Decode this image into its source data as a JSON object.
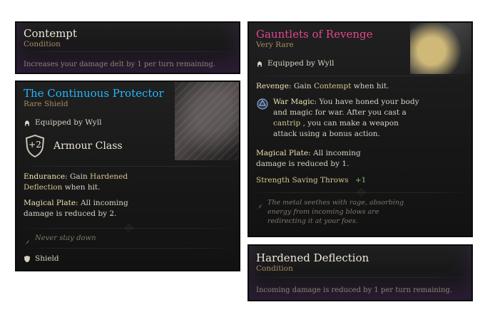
{
  "colors": {
    "title_white": "#ece6d8",
    "title_cyan": "#22b7ff",
    "title_magenta": "#e0478f",
    "sub_brown": "#a88a62",
    "text": "#d9d2c3",
    "gold_label": "#f2e3b3",
    "gold_value": "#d6c48e",
    "green": "#8fbf72",
    "purple_glow": "#5a3278"
  },
  "cards": {
    "contempt": {
      "title": "Contempt",
      "subtitle": "Condition",
      "description": "Increases your damage delt by 1 per turn remaining."
    },
    "protector": {
      "title": "The Continuous Protector",
      "subtitle": "Rare Shield",
      "equipped_label": "Equipped by Wyll",
      "armour_value": "+2",
      "armour_label": "Armour Class",
      "endurance_label": "Endurance:",
      "endurance_text_1": " Gain ",
      "endurance_link": "Hardened Deflection",
      "endurance_text_2": " when hit.",
      "plate_label": "Magical Plate:",
      "plate_text": " All incoming damage is reduced by 2.",
      "quote": "Never stay down",
      "type_label": "Shield"
    },
    "gauntlets": {
      "title": "Gauntlets of Revenge",
      "subtitle": "Very Rare",
      "equipped_label": "Equipped by Wyll",
      "revenge_label": "Revenge:",
      "revenge_text_1": " Gain ",
      "revenge_link": "Contempt",
      "revenge_text_2": " when hit.",
      "warmagic_label": "War Magic:",
      "warmagic_text_1": " You have honed your body and magic for war. After you cast a ",
      "warmagic_link": "cantrip",
      "warmagic_text_2": ", you can make a weapon attack using a bonus action.",
      "plate_label": "Magical Plate:",
      "plate_text": " All incoming damage is reduced by 1.",
      "saving_throws_label": "Strength Saving Throws",
      "saving_throws_value": "+1",
      "flavor": "The metal seethes with rage, absorbing energy from incoming blows are redirecting it at your foes."
    },
    "hardened": {
      "title": "Hardened Deflection",
      "subtitle": "Condition",
      "description": "Incoming damage is reduced by 1 per turn remaining."
    }
  },
  "icons": {
    "equipped": "helmet-icon",
    "armour": "shield-icon",
    "war_magic": "spell-icon",
    "quote": "feather-icon",
    "shield_type": "shield-small-icon"
  }
}
